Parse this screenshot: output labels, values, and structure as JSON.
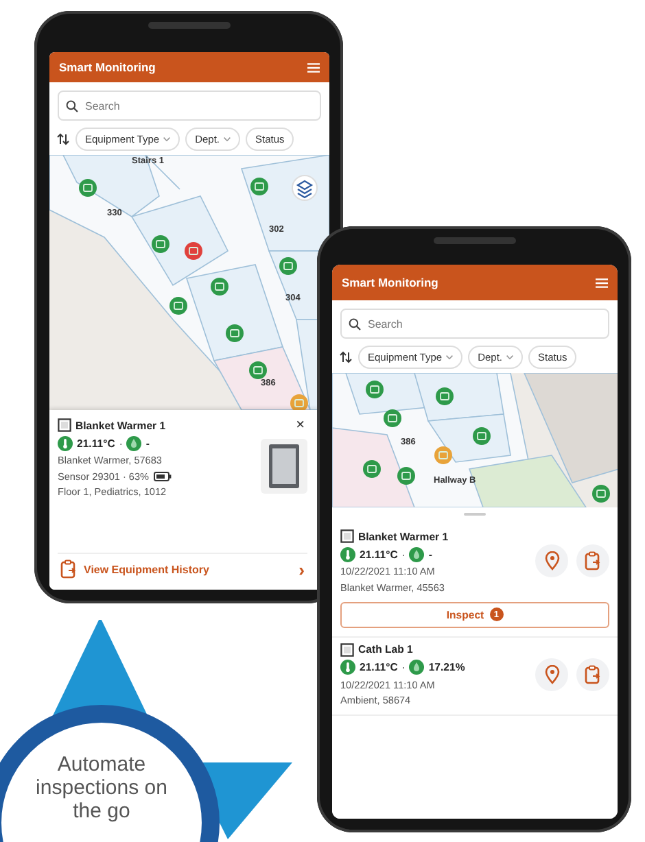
{
  "phones": [
    {
      "kind": "map_detail",
      "app_title": "Smart Monitoring",
      "search": {
        "placeholder": "Search"
      },
      "filters": [
        "Equipment Type",
        "Dept.",
        "Status"
      ],
      "map": {
        "labels": [
          "Stairs 1",
          "330",
          "302",
          "304",
          "386"
        ],
        "markers": [
          {
            "color": "#2e9a4a"
          },
          {
            "color": "#2e9a4a"
          },
          {
            "color": "#2e9a4a"
          },
          {
            "color": "#e0413c"
          },
          {
            "color": "#2e9a4a"
          },
          {
            "color": "#2e9a4a"
          },
          {
            "color": "#2e9a4a"
          },
          {
            "color": "#2e9a4a"
          },
          {
            "color": "#2e9a4a"
          },
          {
            "color": "#e8a33a"
          }
        ]
      },
      "detail_card": {
        "name": "Blanket Warmer 1",
        "temperature": "21.11°C",
        "separator": "·",
        "humidity": "-",
        "model": "Blanket Warmer, 57683",
        "sensor": "Sensor 29301 · 63%",
        "location": "Floor 1, Pediatrics, 1012",
        "close": "×",
        "link": "View Equipment History",
        "chevron": "›"
      }
    },
    {
      "kind": "map_list",
      "app_title": "Smart Monitoring",
      "search": {
        "placeholder": "Search"
      },
      "filters": [
        "Equipment Type",
        "Dept.",
        "Status"
      ],
      "map": {
        "labels": [
          "386",
          "Hallway B"
        ],
        "markers": [
          {
            "color": "#2e9a4a"
          },
          {
            "color": "#2e9a4a"
          },
          {
            "color": "#2e9a4a"
          },
          {
            "color": "#2e9a4a"
          },
          {
            "color": "#2e9a4a"
          },
          {
            "color": "#2e9a4a"
          },
          {
            "color": "#e8a33a"
          },
          {
            "color": "#2e9a4a"
          }
        ]
      },
      "items": [
        {
          "name": "Blanket Warmer 1",
          "temperature": "21.11°C",
          "separator": "·",
          "humidity": "-",
          "time": "10/22/2021 11:10 AM",
          "model": "Blanket Warmer, 45563",
          "inspect": {
            "label": "Inspect",
            "count": "1"
          }
        },
        {
          "name": "Cath Lab 1",
          "temperature": "21.11°C",
          "separator": "·",
          "humidity": "17.21%",
          "time": "10/22/2021 11:10 AM",
          "model": "Ambient, 58674"
        }
      ]
    }
  ],
  "promo": {
    "text": "Automate inspections on the go"
  }
}
